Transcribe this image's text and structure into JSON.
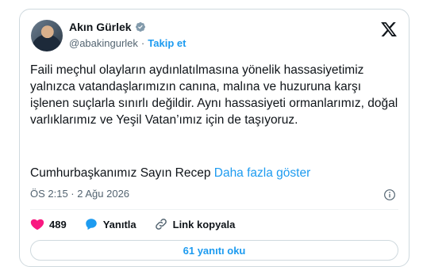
{
  "author": {
    "name": "Akın Gürlek",
    "handle": "@abakingurlek",
    "separator": "·",
    "follow_label": "Takip et"
  },
  "tweet": {
    "paragraph1": "Faili meçhul olayların aydınlatılmasına yönelik hassasiyetimiz yalnızca vatandaşlarımızın canına, malına ve huzuruna karşı işlenen suçlarla sınırlı değildir. Aynı hassasiyeti ormanlarımız, doğal varlıklarımız ve Yeşil Vatan’ımız için de taşıyoruz.",
    "paragraph2": "Cumhurbaşkanımız Sayın Recep",
    "show_more": "Daha fazla göster",
    "timestamp": "ÖS 2:15 · 2 Ağu 2026"
  },
  "actions": {
    "likes": "489",
    "reply_label": "Yanıtla",
    "copy_link_label": "Link kopyala"
  },
  "replies_button": "61 yanıtı oku",
  "colors": {
    "accent": "#1d9bf0",
    "like": "#f91880",
    "text": "#0f1419",
    "muted": "#536471"
  }
}
